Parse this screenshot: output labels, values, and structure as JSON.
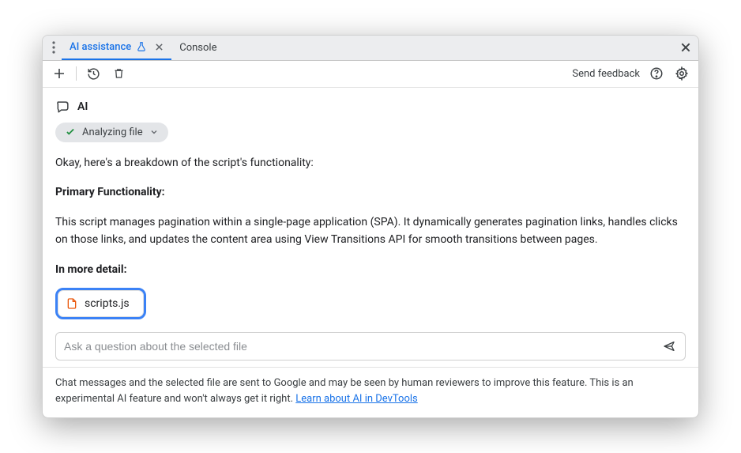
{
  "tabs": {
    "active": "AI assistance",
    "inactive": "Console"
  },
  "toolbar": {
    "feedback": "Send feedback"
  },
  "ai": {
    "label": "AI",
    "chip": "Analyzing file"
  },
  "response": {
    "intro": "Okay, here's a breakdown of the script's functionality:",
    "h1": "Primary Functionality:",
    "p1": "This script manages pagination within a single-page application (SPA). It dynamically generates pagination links, handles clicks on those links, and updates the content area using View Transitions API for smooth transitions between pages.",
    "h2": "In more detail:"
  },
  "file": {
    "name": "scripts.js"
  },
  "input": {
    "placeholder": "Ask a question about the selected file"
  },
  "footer": {
    "text": "Chat messages and the selected file are sent to Google and may be seen by human reviewers to improve this feature. This is an experimental AI feature and won't always get it right. ",
    "link": "Learn about AI in DevTools"
  }
}
